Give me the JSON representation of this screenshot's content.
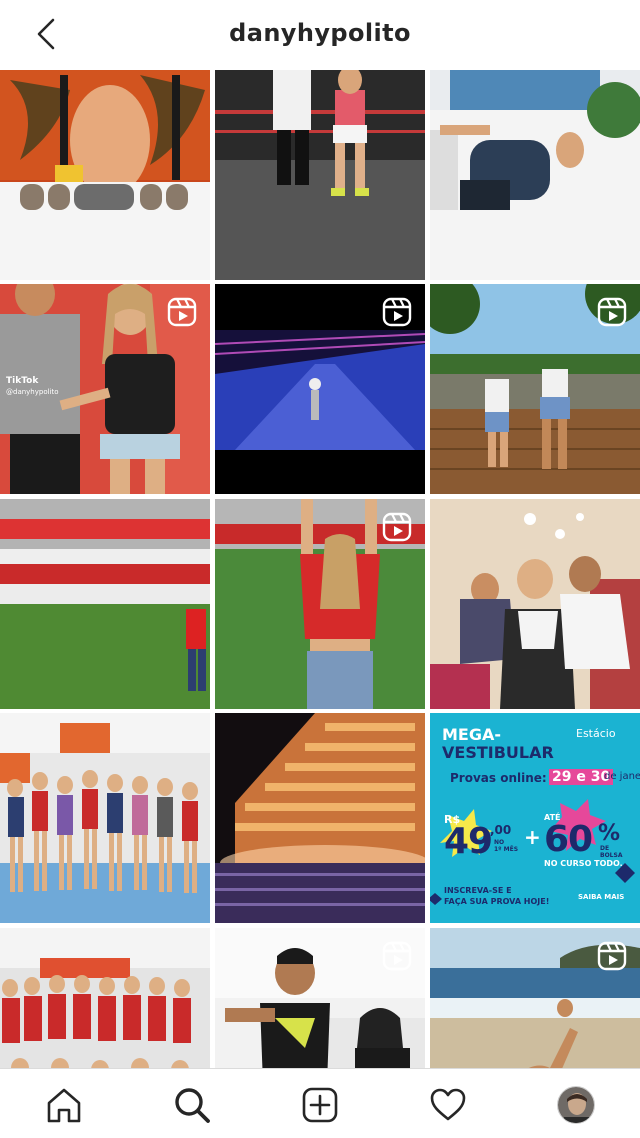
{
  "header": {
    "username": "danyhypolito"
  },
  "grid": {
    "tiles": [
      {
        "kind": "photo",
        "reel": false
      },
      {
        "kind": "photo",
        "reel": false
      },
      {
        "kind": "photo",
        "reel": false
      },
      {
        "kind": "photo",
        "reel": true,
        "watermark": "TikTok",
        "watermark_handle": "@danyhypolito"
      },
      {
        "kind": "photo",
        "reel": true
      },
      {
        "kind": "photo",
        "reel": true
      },
      {
        "kind": "photo",
        "reel": false
      },
      {
        "kind": "photo",
        "reel": true
      },
      {
        "kind": "photo",
        "reel": false
      },
      {
        "kind": "photo",
        "reel": false
      },
      {
        "kind": "photo",
        "reel": false
      },
      {
        "kind": "promo",
        "reel": false
      },
      {
        "kind": "photo",
        "reel": false
      },
      {
        "kind": "photo",
        "reel": true
      },
      {
        "kind": "photo",
        "reel": true
      }
    ]
  },
  "promo": {
    "brand": "Estácio",
    "headline_1": "MEGA-",
    "headline_2": "VESTIBULAR",
    "provas": "Provas online:",
    "dates": "29 e 30",
    "dates_suffix": "de janeiro.",
    "price_currency": "R$",
    "price_main": "49",
    "price_cents": ",00",
    "price_note_1": "NO",
    "price_note_2": "1º MÊS",
    "plus": "+",
    "ate": "ATÉ",
    "discount": "60",
    "percent": "%",
    "discount_note_1": "DE",
    "discount_note_2": "BOLSA",
    "course_note": "NO CURSO TODO.",
    "cta_1": "INSCREVA-SE E",
    "cta_2": "FAÇA SUA PROVA HOJE!",
    "saiba": "SAIBA MAIS"
  },
  "colors": {
    "promo_bg": "#1bb3d2",
    "promo_navy": "#1d2a6b",
    "promo_yellow": "#f6e94a",
    "promo_pink": "#e6489a"
  },
  "icons": [
    "back-arrow-icon",
    "reel-icon",
    "home-icon",
    "search-icon",
    "new-post-icon",
    "heart-icon"
  ]
}
